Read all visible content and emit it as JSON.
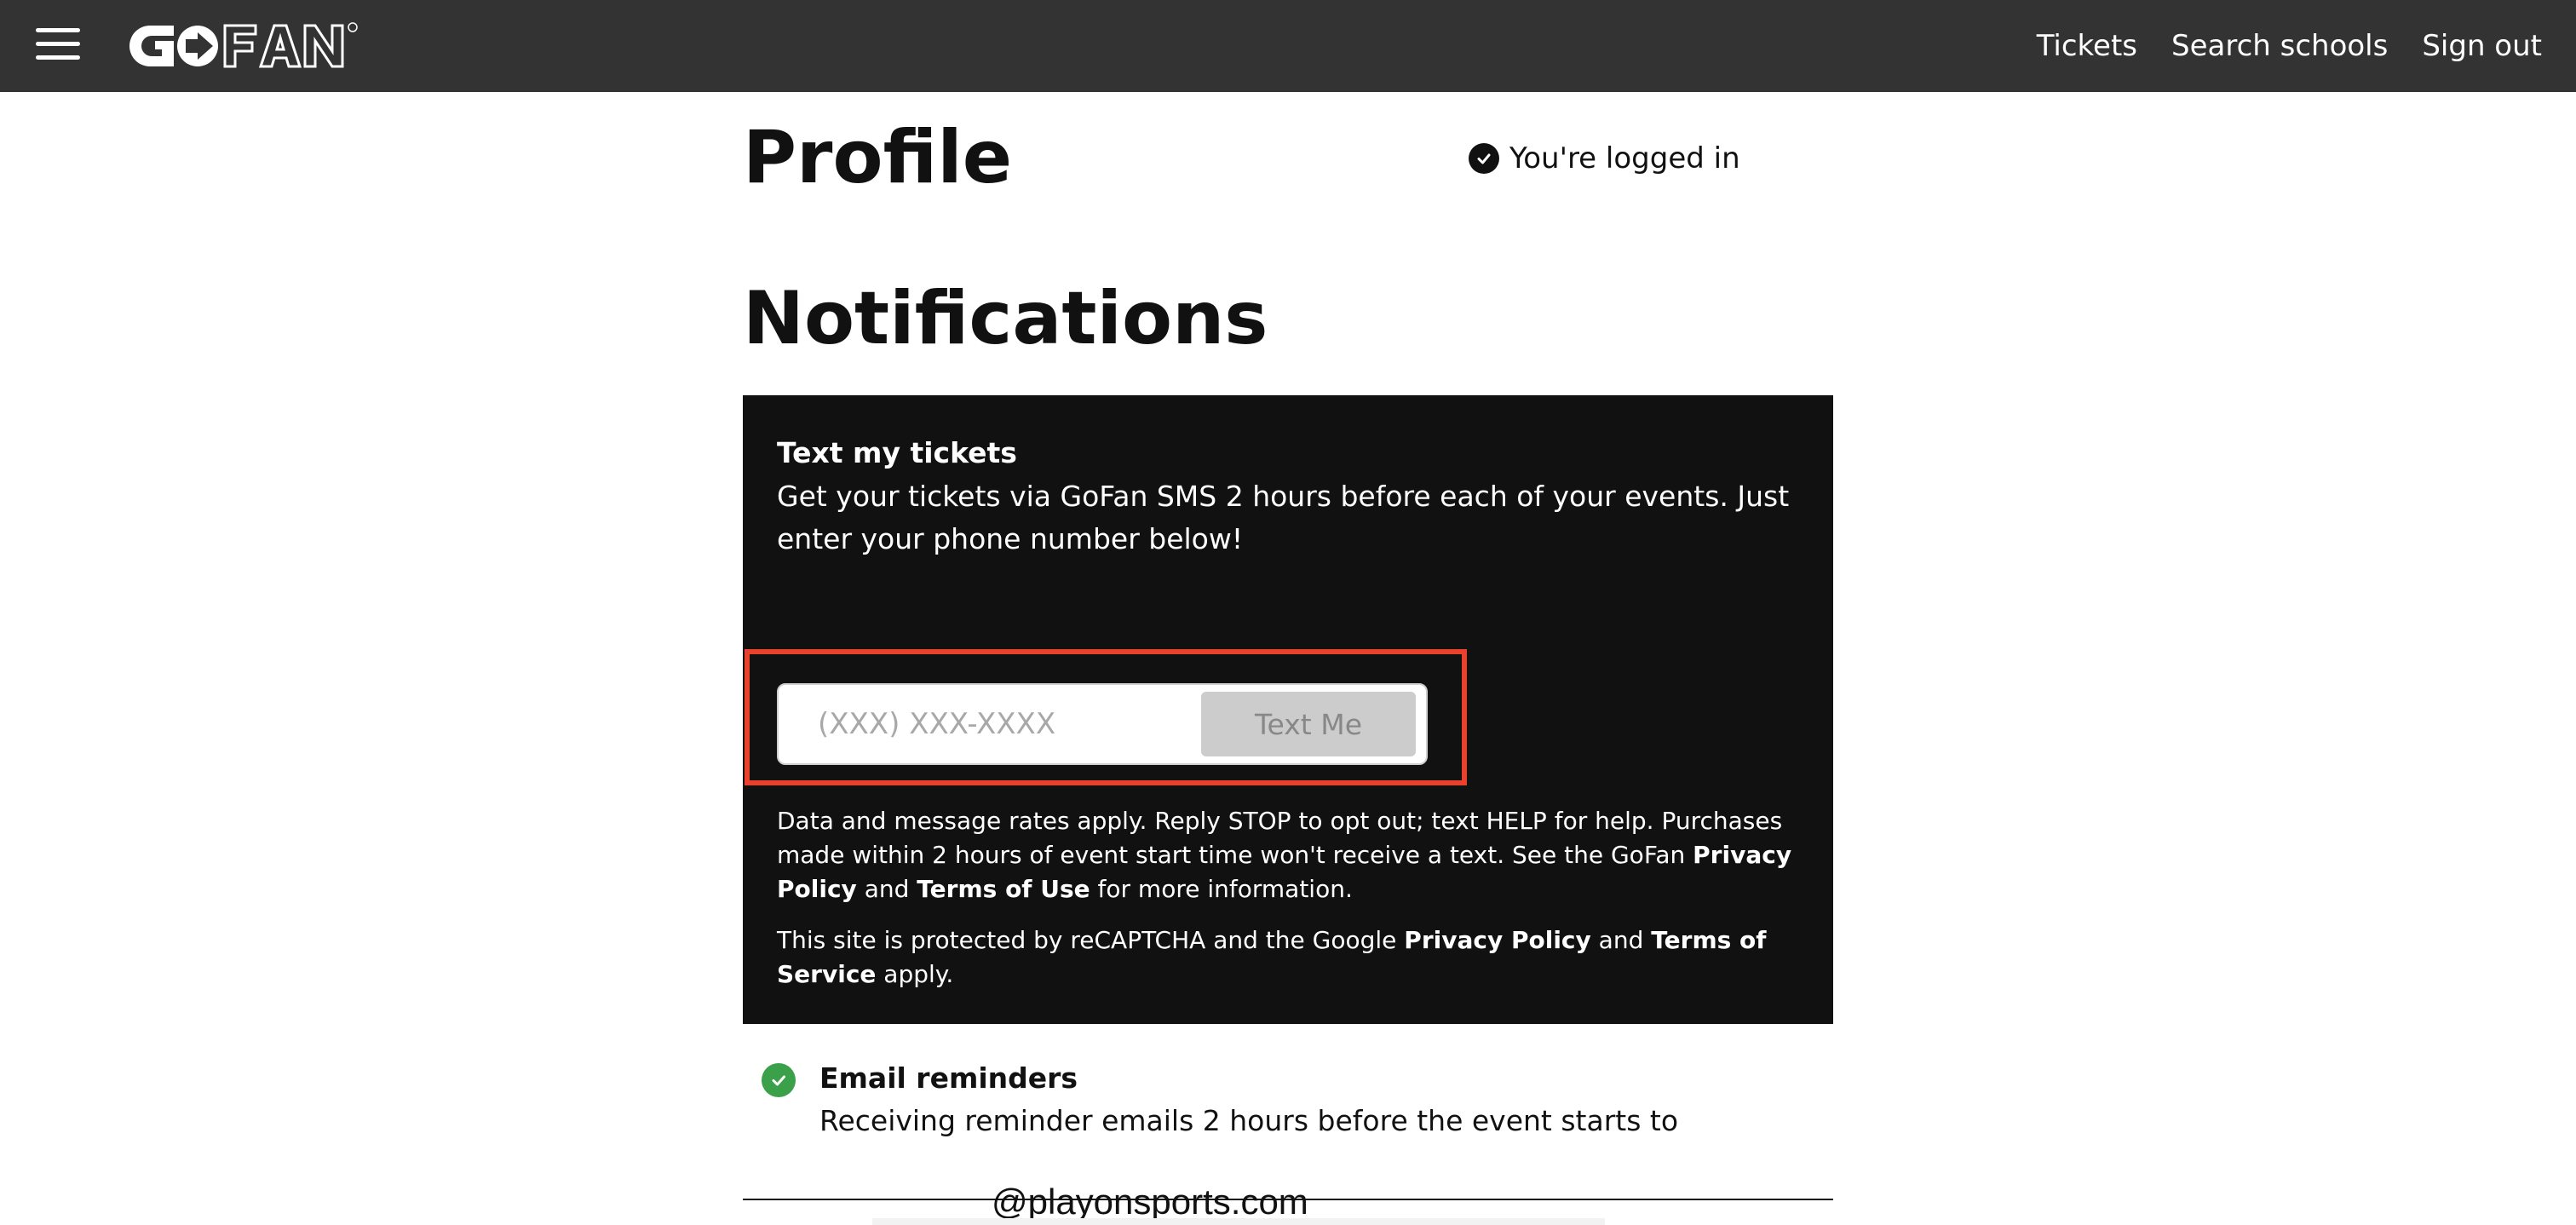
{
  "navbar": {
    "logo_text": "GOFAN",
    "links": {
      "tickets": "Tickets",
      "search_schools": "Search schools",
      "sign_out": "Sign out"
    }
  },
  "profile": {
    "title": "Profile",
    "status": "You're logged in"
  },
  "notifications": {
    "title": "Notifications",
    "sms": {
      "heading": "Text my tickets",
      "description": "Get your tickets via GoFan SMS 2 hours before each of your events. Just enter your phone number below!",
      "phone_value": "",
      "phone_placeholder": "(XXX) XXX-XXXX",
      "button_label": "Text Me",
      "legal1": {
        "text_a": "Data and message rates apply. Reply STOP to opt out; text HELP for help. Purchases made within 2 hours of event start time won't receive a text. See the GoFan ",
        "privacy_link": "Privacy Policy",
        "text_b": " and ",
        "terms_link": "Terms of Use",
        "text_c": " for more information."
      },
      "legal2": {
        "text_a": "This site is protected by reCAPTCHA and the Google ",
        "privacy_link": "Privacy Policy",
        "text_b": " and ",
        "terms_link": "Terms of Service",
        "text_c": " apply."
      }
    },
    "email": {
      "title": "Email reminders",
      "description": "Receiving reminder emails 2 hours before the event starts to",
      "address": "@playonsports.com"
    }
  },
  "colors": {
    "navbar_bg": "#333333",
    "panel_bg": "#111111",
    "highlight": "#e8412c",
    "success_green": "#3aa14a"
  }
}
